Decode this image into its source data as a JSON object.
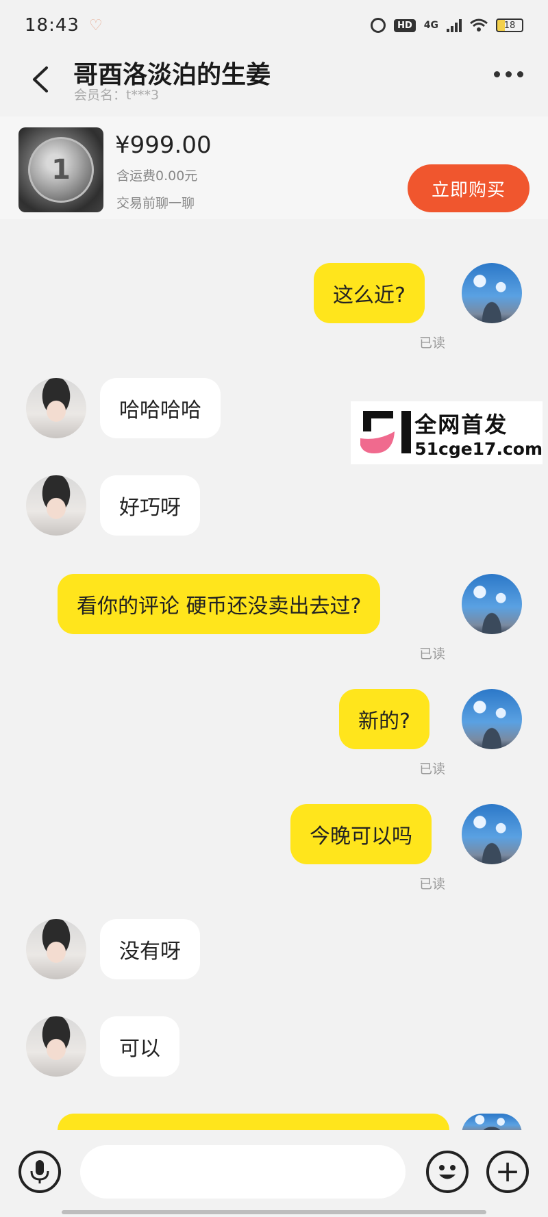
{
  "status_bar": {
    "time": "18:43",
    "network": "4G",
    "hd": "HD",
    "battery": "18"
  },
  "header": {
    "title": "哥酉洛淡泊的生姜",
    "member_label": "会员名：",
    "member_name": "t***3"
  },
  "product": {
    "price": "¥999.00",
    "shipping": "含运费0.00元",
    "hint": "交易前聊一聊",
    "buy_label": "立即购买",
    "coin_glyph": "1"
  },
  "messages": [
    {
      "side": "out",
      "text": "这么近?",
      "status": "已读"
    },
    {
      "side": "in",
      "text": "哈哈哈哈"
    },
    {
      "side": "in",
      "text": "好巧呀"
    },
    {
      "side": "out",
      "text": "看你的评论  硬币还没卖出去过?",
      "status": "已读"
    },
    {
      "side": "out",
      "text": "新的?",
      "status": "已读"
    },
    {
      "side": "out",
      "text": "今晚可以吗",
      "status": "已读"
    },
    {
      "side": "in",
      "text": "没有呀"
    },
    {
      "side": "in",
      "text": "可以"
    }
  ],
  "watermark": {
    "title": "全网首发",
    "site": "51cge17.com"
  },
  "input": {
    "placeholder": "",
    "plus_glyph": "+"
  },
  "colors": {
    "outgoing_bubble": "#ffe51c",
    "incoming_bubble": "#ffffff",
    "buy_button": "#f0562e",
    "background": "#f2f2f2"
  },
  "icons": [
    "back-icon",
    "more-icon",
    "mic-icon",
    "emoji-icon",
    "plus-icon",
    "alarm-icon",
    "wifi-icon",
    "battery-icon",
    "signal-icon"
  ]
}
